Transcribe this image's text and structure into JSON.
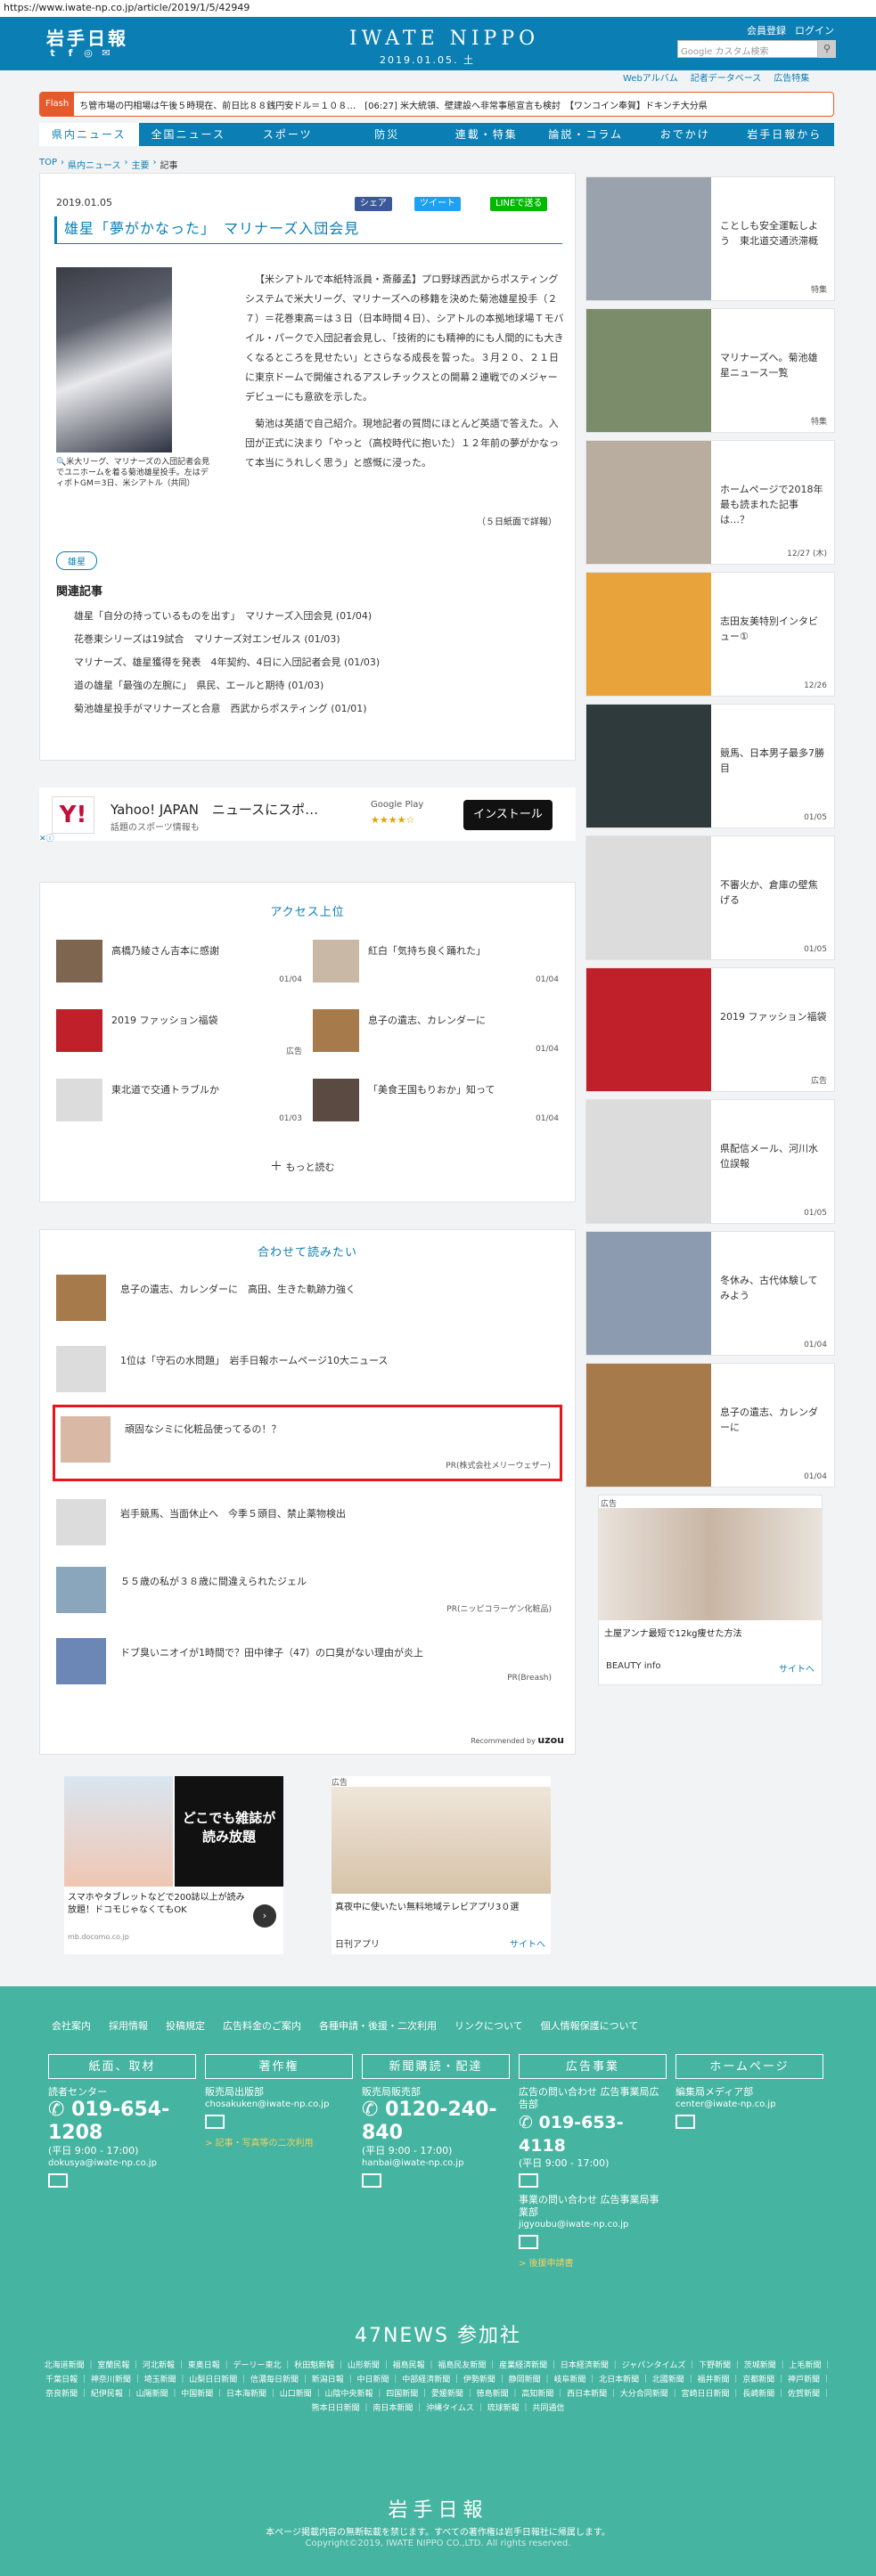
{
  "url": "https://www.iwate-np.co.jp/article/2019/1/5/42949",
  "header": {
    "logo_jp": "岩手日報",
    "logo_en": "IWATE NIPPO",
    "date": "2019.01.05. 土",
    "member_register": "会員登録",
    "login": "ログイン",
    "search_placeholder": "Google カスタム検索",
    "subnav": [
      "Webアルバム",
      "記者データベース",
      "広告特集"
    ]
  },
  "flash": {
    "label": "Flash",
    "text": "ち管市場の円相場は午後５時現在、前日比８８銭円安ドル＝１０８…　[06:27] 米大統領、壁建設へ非常事態宣言も検討　【ワンコイン奉賀】ドキンチ大分県"
  },
  "nav": [
    "県内ニュース",
    "全国ニュース",
    "スポーツ",
    "防災",
    "連載・特集",
    "論説・コラム",
    "おでかけ",
    "岩手日報から"
  ],
  "breadcrumb": [
    "TOP",
    "県内ニュース",
    "主要",
    "記事"
  ],
  "article": {
    "date": "2019.01.05",
    "share_fb": "シェア",
    "share_tw": "ツイート",
    "share_line": "LINEで送る",
    "title": "雄星「夢がかなった」　マリナーズ入団会見",
    "caption": "米大リーグ、マリナーズの入団記者会見でユニホームを着る菊池雄星投手。左はディポトGM＝3日、米シアトル（共同）",
    "body": [
      "【米シアトルで本紙特派員・斎藤孟】プロ野球西武からポスティングシステムで米大リーグ、マリナーズへの移籍を決めた菊池雄星投手（２７）＝花巻東高＝は３日（日本時間４日）、シアトルの本拠地球場Ｔモバイル・パークで入団記者会見し、「技術的にも精神的にも人間的にも大きくなるところを見せたい」とさらなる成長を誓った。３月２０、２１日に東京ドームで開催されるアスレチックスとの開幕２連戦でのメジャーデビューにも意欲を示した。",
      "菊池は英語で自己紹介。現地記者の質問にほとんど英語で答えた。入団が正式に決まり「やっと（高校時代に抱いた）１２年前の夢がかなって本当にうれしく思う」と感慨に浸った。"
    ],
    "source": "（５日紙面で詳報）",
    "tag": "雄星",
    "related_title": "関連記事",
    "related": [
      "雄星「自分の持っているものを出す」　マリナーズ入団会見 (01/04)",
      "花巻東シリーズは19試合　マリナーズ対エンゼルス (01/03)",
      "マリナーズ、雄星獲得を発表　4年契約、4日に入団記者会見 (01/03)",
      "道の雄星「最強の左腕に」　県民、エールと期待 (01/03)",
      "菊池雄星投手がマリナーズと合意　西武からポスティング (01/01)"
    ]
  },
  "ad_yahoo": {
    "title": "Yahoo! JAPAN　ニュースにスポ…",
    "sub": "話題のスポーツ情報も",
    "store": "Google Play",
    "rating": "★★★★☆",
    "button": "インストール"
  },
  "access": {
    "title": "アクセス上位",
    "items": [
      {
        "text": "高橋乃綾さん吉本に感謝",
        "date": "01/04"
      },
      {
        "text": "紅白「気持ち良く踊れた」",
        "date": "01/04"
      },
      {
        "text": "2019 ファッション福袋",
        "date": "広告"
      },
      {
        "text": "息子の遺志、カレンダーに",
        "date": "01/04"
      },
      {
        "text": "東北道で交通トラブルか",
        "date": "01/03"
      },
      {
        "text": "「美食王国もりおか」知って",
        "date": "01/04"
      }
    ],
    "more": "もっと読む"
  },
  "together": {
    "title": "合わせて読みたい",
    "items": [
      {
        "text": "息子の遺志、カレンダーに　高田、生きた軌跡力強く",
        "pr": ""
      },
      {
        "text": "1位は「守石の水問題」　岩手日報ホームページ10大ニュース",
        "pr": ""
      },
      {
        "text": "頑固なシミに化粧品使ってるの！？",
        "pr": "PR(株式会社メリーウェザー)"
      },
      {
        "text": "岩手競馬、当面休止へ　今季５頭目、禁止薬物検出",
        "pr": ""
      },
      {
        "text": "５５歳の私が３８歳に間違えられたジェル",
        "pr": "PR(ニッピコラーゲン化粧品)"
      },
      {
        "text": "ドブ臭いニオイが1時間で？田中律子（47）の口臭がない理由が炎上",
        "pr": "PR(Breash)"
      }
    ],
    "recommended": "Recommended by",
    "recommended_brand": "uzou"
  },
  "ads_bottom": [
    {
      "title": "どこでも雑誌が読み放題",
      "sub": "スマホやタブレットなどで200誌以上が読み放題！ドコモじゃなくてもOK",
      "domain": "mb.docomo.co.jp"
    },
    {
      "title": "真夜中に使いたい無料地域テレビアプリ3０選",
      "sub": "日刊アプリ",
      "link": "サイトへ",
      "label": "広告"
    }
  ],
  "sidebar": [
    {
      "text": "ことしも安全運転しよう　東北道交通渋滞概",
      "date": "特集",
      "thumb": "#9aa3ad"
    },
    {
      "text": "マリナーズへ。菊池雄星ニュース一覧",
      "date": "特集",
      "thumb": "#7b8c6a"
    },
    {
      "text": "ホームページで2018年最も読まれた記事は…？",
      "date": "12/27 (木)",
      "thumb": "#b9ada0"
    },
    {
      "text": "志田友美特別インタビュー①",
      "date": "12/26",
      "thumb": "#e8a33a"
    },
    {
      "text": "競馬、日本男子最多7勝目",
      "date": "01/05",
      "thumb": "#2e3a3c"
    },
    {
      "text": "不審火か、倉庫の壁焦げる",
      "date": "01/05",
      "thumb": "#dcdcdc"
    },
    {
      "text": "2019 ファッション福袋",
      "date": "広告",
      "thumb": "#c0202a"
    },
    {
      "text": "県配信メール、河川水位誤報",
      "date": "01/05",
      "thumb": "#dcdcdc"
    },
    {
      "text": "冬休み、古代体験してみよう",
      "date": "01/04",
      "thumb": "#8c9bb0"
    },
    {
      "text": "息子の遺志、カレンダーに",
      "date": "01/04",
      "thumb": "#a77a4b"
    }
  ],
  "side_ad": {
    "label": "広告",
    "caption": "土屋アンナ最短で12kg痩せた方法",
    "brand": "BEAUTY info",
    "link": "サイトへ"
  },
  "footer": {
    "links": [
      "会社案内",
      "採用情報",
      "投稿規定",
      "広告料金のご案内",
      "各種申請・後援・二次利用",
      "リンクについて",
      "個人情報保護について"
    ],
    "cols": [
      {
        "btn": "紙面、取材",
        "label": "読者センター",
        "tel": "019-654-1208",
        "hours": "(平日 9:00 - 17:00)",
        "mail": "dokusya@iwate-np.co.jp",
        "extra": ""
      },
      {
        "btn": "著作権",
        "label": "販売局出版部",
        "tel": "",
        "hours": "",
        "mail": "chosakuken@iwate-np.co.jp",
        "extra": "> 記事・写真等の二次利用"
      },
      {
        "btn": "新聞購読・配達",
        "label": "販売局販売部",
        "tel": "0120-240-840",
        "hours": "(平日 9:00 - 17:00)",
        "mail": "hanbai@iwate-np.co.jp",
        "extra": ""
      },
      {
        "btn": "広告事業",
        "label": "広告の問い合わせ 広告事業局広告部",
        "tel": "019-653-4118",
        "hours": "(平日 9:00 - 17:00)",
        "mail": "jigyoubu@iwate-np.co.jp",
        "extra": "> 後援申請書"
      },
      {
        "btn": "ホームページ",
        "label": "編集局メディア部",
        "tel": "",
        "hours": "",
        "mail": "center@iwate-np.co.jp",
        "extra": ""
      }
    ],
    "event_label": "事業の問い合わせ 広告事業局事業部",
    "title47": "47NEWS 参加社",
    "papers": "北海道新聞 ｜ 室蘭民報 ｜ 河北新報 ｜ 東奥日報 ｜ デーリー東北 ｜ 秋田魁新報 ｜ 山形新聞 ｜ 福島民報 ｜ 福島民友新聞 ｜ 産業経済新聞 ｜ 日本経済新聞 ｜ ジャパンタイムズ ｜ 下野新聞 ｜ 茨城新聞 ｜ 上毛新聞 ｜ 千葉日報 ｜ 神奈川新聞 ｜ 埼玉新聞 ｜ 山梨日日新聞 ｜ 信濃毎日新聞 ｜ 新潟日報 ｜ 中日新聞 ｜ 中部経済新聞 ｜ 伊勢新聞 ｜ 静岡新聞 ｜ 岐阜新聞 ｜ 北日本新聞 ｜ 北國新聞 ｜ 福井新聞 ｜ 京都新聞 ｜ 神戸新聞 ｜ 奈良新聞 ｜ 紀伊民報 ｜ 山陽新聞 ｜ 中国新聞 ｜ 日本海新聞 ｜ 山口新聞 ｜ 山陰中央新報 ｜ 四国新聞 ｜ 愛媛新聞 ｜ 徳島新聞 ｜ 高知新聞 ｜ 西日本新聞 ｜ 大分合同新聞 ｜ 宮崎日日新聞 ｜ 長崎新聞 ｜ 佐賀新聞 ｜ 熊本日日新聞 ｜ 南日本新聞 ｜ 沖縄タイムス ｜ 琉球新報 ｜ 共同通信",
    "logo": "岩手日報",
    "note": "本ページ掲載内容の無断転載を禁じます。すべての著作権は岩手日報社に帰属します。",
    "copyright": "Copyright©2019, IWATE NIPPO CO.,LTD. All rights reserved."
  }
}
